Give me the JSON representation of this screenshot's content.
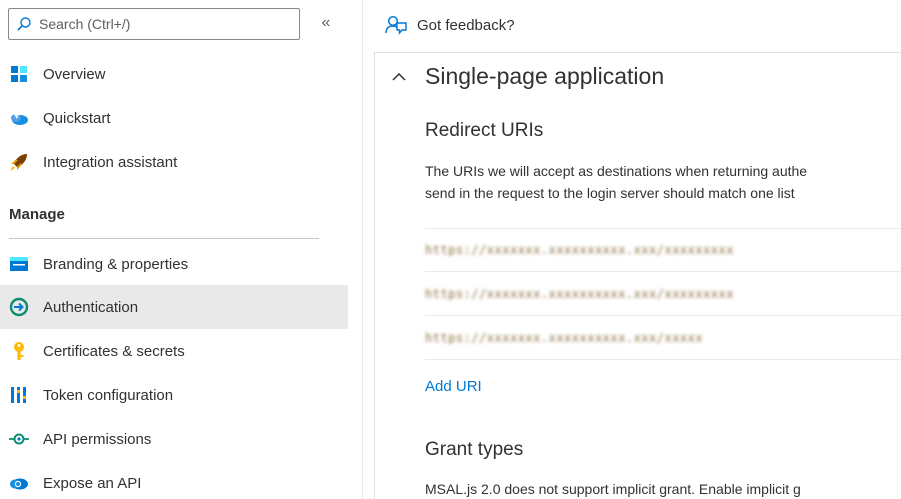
{
  "sidebar": {
    "search_placeholder": "Search (Ctrl+/)",
    "collapse_glyph": "«",
    "items_top": [
      {
        "label": "Overview",
        "icon": "overview-icon"
      },
      {
        "label": "Quickstart",
        "icon": "quickstart-icon"
      },
      {
        "label": "Integration assistant",
        "icon": "rocket-icon"
      }
    ],
    "manage_heading": "Manage",
    "items_manage": [
      {
        "label": "Branding & properties",
        "icon": "branding-icon"
      },
      {
        "label": "Authentication",
        "icon": "authentication-icon",
        "active": true
      },
      {
        "label": "Certificates & secrets",
        "icon": "key-icon"
      },
      {
        "label": "Token configuration",
        "icon": "token-icon"
      },
      {
        "label": "API permissions",
        "icon": "api-permissions-icon"
      },
      {
        "label": "Expose an API",
        "icon": "cloud-icon"
      }
    ]
  },
  "toolbar": {
    "feedback_label": "Got feedback?",
    "feedback_icon": "feedback-icon"
  },
  "card": {
    "title": "Single-page application",
    "redirect_heading": "Redirect URIs",
    "redirect_desc_line1": "The URIs we will accept as destinations when returning authe",
    "redirect_desc_line2": "send in the request to the login server should match one list",
    "uris": [
      "https://xxxxxxx.xxxxxxxxxx.xxx/xxxxxxxxx",
      "https://xxxxxxx.xxxxxxxxxx.xxx/xxxxxxxxx",
      "https://xxxxxxx.xxxxxxxxxx.xxx/xxxxx"
    ],
    "add_uri_label": "Add URI",
    "grant_heading": "Grant types",
    "grant_desc": "MSAL.js 2.0 does not support implicit grant. Enable implicit g"
  },
  "colors": {
    "accent": "#0078d4",
    "active_bg": "#e9e9e9",
    "text": "#323130"
  }
}
